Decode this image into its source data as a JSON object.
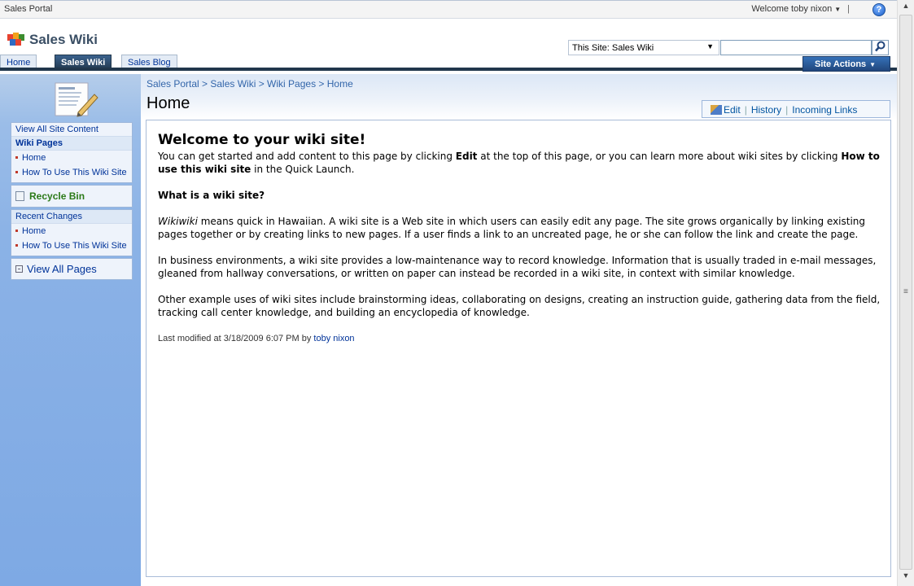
{
  "global": {
    "portal_crumb": "Sales Portal",
    "welcome": "Welcome toby nixon",
    "pipe": "|",
    "help_glyph": "?"
  },
  "header": {
    "site_title": "Sales Wiki",
    "search_scope": "This Site: Sales Wiki",
    "search_value": "",
    "site_actions": "Site Actions"
  },
  "tabs": [
    {
      "label": "Home"
    },
    {
      "label": "Sales Wiki"
    },
    {
      "label": "Sales Blog"
    }
  ],
  "quicklaunch": {
    "view_all_content": "View All Site Content",
    "wiki_pages_header": "Wiki Pages",
    "wiki_pages": [
      "Home",
      "How To Use This Wiki Site"
    ],
    "recycle_bin": "Recycle Bin",
    "recent_changes_header": "Recent Changes",
    "recent_changes": [
      "Home",
      "How To Use This Wiki Site"
    ],
    "view_all_pages": "View All Pages"
  },
  "page": {
    "breadcrumb": "Sales Portal > Sales Wiki > Wiki Pages > Home",
    "title": "Home",
    "actions": {
      "edit": "Edit",
      "sep": "|",
      "history": "History",
      "incoming": "Incoming Links"
    }
  },
  "content": {
    "heading": "Welcome to your wiki site!",
    "intro_1": "You can get started and add content to this page by clicking ",
    "intro_edit": "Edit",
    "intro_2": " at the top of this page, or you can learn more about wiki sites by clicking ",
    "intro_link": "How to use this wiki site",
    "intro_3": " in the Quick Launch.",
    "subhead": "What is a wiki site?",
    "p1_term": "Wikiwiki",
    "p1_rest": " means quick in Hawaiian. A wiki site is a Web site in which users can easily edit any page. The site grows organically by linking existing pages together or by creating links to new pages. If a user finds a link to an uncreated page, he or she can follow the link and create the page.",
    "p2": "In business environments, a wiki site provides a low-maintenance way to record knowledge. Information that is usually traded in e-mail messages, gleaned from hallway conversations, or written on paper can instead be recorded in a wiki site, in context with similar knowledge.",
    "p3": "Other example uses of wiki sites include brainstorming ideas, collaborating on designs, creating an instruction guide, gathering data from the field, tracking call center knowledge, and building an encyclopedia of knowledge.",
    "lastmod_prefix": "Last modified at 3/18/2009 6:07 PM  by ",
    "lastmod_user": "toby nixon"
  }
}
